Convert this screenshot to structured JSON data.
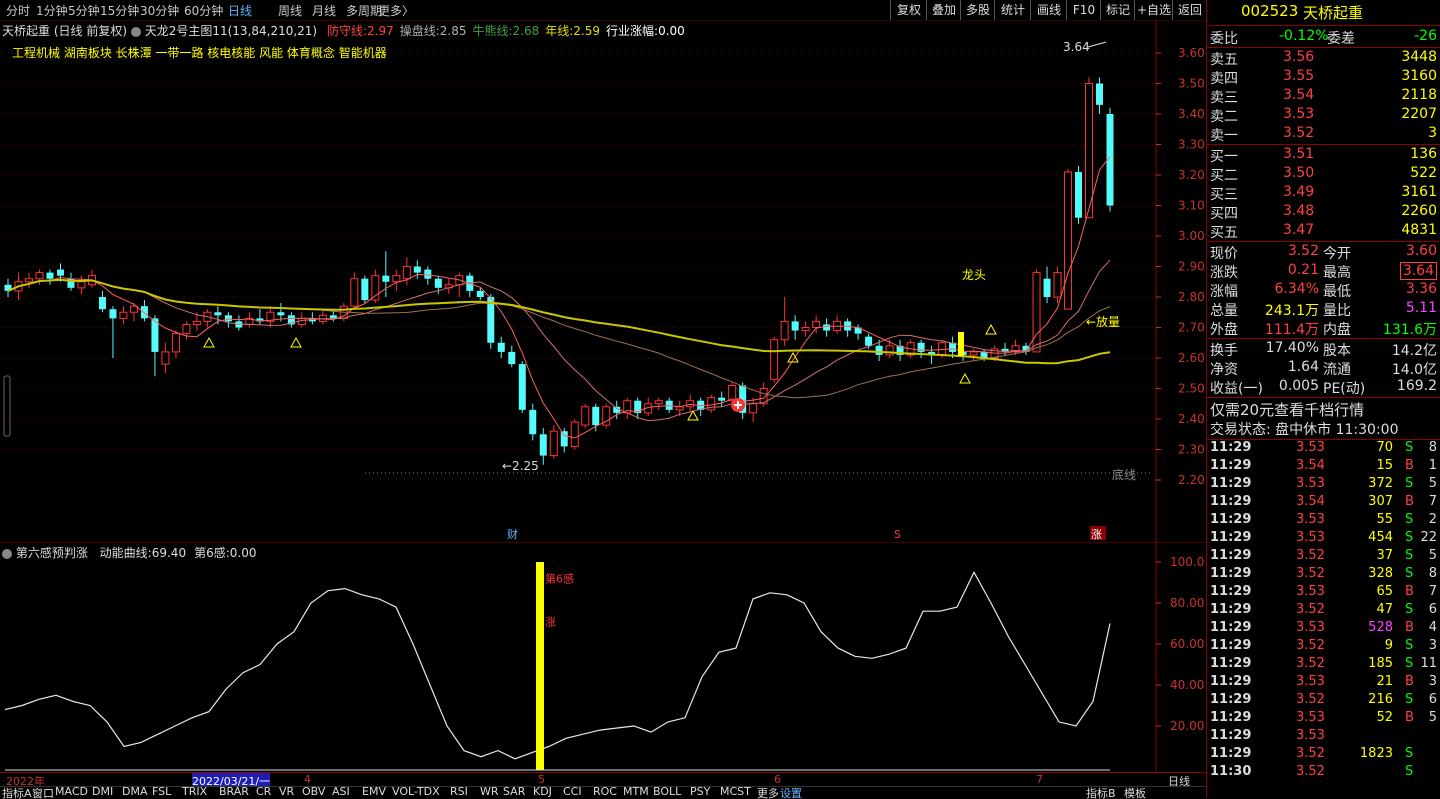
{
  "toolbar": {
    "periods": [
      "分时",
      "1分钟",
      "5分钟",
      "15分钟",
      "30分钟",
      "60分钟",
      "日线",
      "周线",
      "月线",
      "多周期",
      "更多〉"
    ],
    "active_period": "日线",
    "buttons": [
      "复权",
      "叠加",
      "多股",
      "统计",
      "画线",
      "F10",
      "标记",
      "+自选",
      "返回"
    ]
  },
  "main_header": {
    "stock_name": "天桥起重",
    "mode": "(日线 前复权)",
    "indicator_name": "天龙2号主图11(13,84,210,21)",
    "items": [
      {
        "label": "防守线:",
        "value": "2.97",
        "color": "#ff4040"
      },
      {
        "label": "操盘线:",
        "value": "2.85",
        "color": "#b0b0b0"
      },
      {
        "label": "牛熊线:",
        "value": "2.68",
        "color": "#40a040"
      },
      {
        "label": "年线:",
        "value": "2.59",
        "color": "#e0e000"
      },
      {
        "label": "行业涨幅:",
        "value": "0.00",
        "color": "#ffffff"
      }
    ],
    "concepts": "工程机械 湖南板块 长株潭 一带一路 核电核能 风能 体育概念 智能机器"
  },
  "price_axis": [
    "3.60",
    "3.50",
    "3.40",
    "3.30",
    "3.20",
    "3.10",
    "3.00",
    "2.90",
    "2.80",
    "2.70",
    "2.60",
    "2.50",
    "2.40",
    "2.30",
    "2.20"
  ],
  "annotations": {
    "high_label": "3.64",
    "low_label": "2.25",
    "bottom_line": "底线",
    "volume_label": "放量",
    "dragon_label": "龙头",
    "marker_cai": "财",
    "marker_s": "S",
    "marker_zhang": "涨"
  },
  "candles": [
    {
      "o": 2.84,
      "c": 2.82,
      "h": 2.86,
      "l": 2.8
    },
    {
      "o": 2.82,
      "c": 2.85,
      "h": 2.88,
      "l": 2.79
    },
    {
      "o": 2.85,
      "c": 2.86,
      "h": 2.88,
      "l": 2.83
    },
    {
      "o": 2.86,
      "c": 2.88,
      "h": 2.89,
      "l": 2.84
    },
    {
      "o": 2.88,
      "c": 2.86,
      "h": 2.89,
      "l": 2.84
    },
    {
      "o": 2.89,
      "c": 2.87,
      "h": 2.91,
      "l": 2.85
    },
    {
      "o": 2.86,
      "c": 2.83,
      "h": 2.88,
      "l": 2.82
    },
    {
      "o": 2.83,
      "c": 2.85,
      "h": 2.87,
      "l": 2.81
    },
    {
      "o": 2.84,
      "c": 2.87,
      "h": 2.89,
      "l": 2.83
    },
    {
      "o": 2.8,
      "c": 2.76,
      "h": 2.82,
      "l": 2.75
    },
    {
      "o": 2.76,
      "c": 2.73,
      "h": 2.77,
      "l": 2.6
    },
    {
      "o": 2.73,
      "c": 2.75,
      "h": 2.77,
      "l": 2.71
    },
    {
      "o": 2.75,
      "c": 2.77,
      "h": 2.78,
      "l": 2.72
    },
    {
      "o": 2.77,
      "c": 2.73,
      "h": 2.79,
      "l": 2.72
    },
    {
      "o": 2.73,
      "c": 2.62,
      "h": 2.74,
      "l": 2.54
    },
    {
      "o": 2.58,
      "c": 2.62,
      "h": 2.65,
      "l": 2.55
    },
    {
      "o": 2.62,
      "c": 2.68,
      "h": 2.69,
      "l": 2.6
    },
    {
      "o": 2.68,
      "c": 2.71,
      "h": 2.72,
      "l": 2.66
    },
    {
      "o": 2.71,
      "c": 2.72,
      "h": 2.75,
      "l": 2.69
    },
    {
      "o": 2.72,
      "c": 2.75,
      "h": 2.76,
      "l": 2.7
    },
    {
      "o": 2.75,
      "c": 2.74,
      "h": 2.77,
      "l": 2.71
    },
    {
      "o": 2.74,
      "c": 2.72,
      "h": 2.75,
      "l": 2.7
    },
    {
      "o": 2.72,
      "c": 2.7,
      "h": 2.74,
      "l": 2.69
    },
    {
      "o": 2.71,
      "c": 2.73,
      "h": 2.75,
      "l": 2.7
    },
    {
      "o": 2.73,
      "c": 2.72,
      "h": 2.76,
      "l": 2.71
    },
    {
      "o": 2.72,
      "c": 2.75,
      "h": 2.77,
      "l": 2.7
    },
    {
      "o": 2.75,
      "c": 2.74,
      "h": 2.78,
      "l": 2.72
    },
    {
      "o": 2.74,
      "c": 2.71,
      "h": 2.75,
      "l": 2.7
    },
    {
      "o": 2.71,
      "c": 2.73,
      "h": 2.75,
      "l": 2.7
    },
    {
      "o": 2.73,
      "c": 2.72,
      "h": 2.75,
      "l": 2.71
    },
    {
      "o": 2.72,
      "c": 2.74,
      "h": 2.76,
      "l": 2.71
    },
    {
      "o": 2.74,
      "c": 2.73,
      "h": 2.76,
      "l": 2.72
    },
    {
      "o": 2.73,
      "c": 2.77,
      "h": 2.78,
      "l": 2.72
    },
    {
      "o": 2.77,
      "c": 2.86,
      "h": 2.88,
      "l": 2.76
    },
    {
      "o": 2.86,
      "c": 2.79,
      "h": 2.87,
      "l": 2.78
    },
    {
      "o": 2.79,
      "c": 2.87,
      "h": 2.89,
      "l": 2.78
    },
    {
      "o": 2.87,
      "c": 2.85,
      "h": 2.95,
      "l": 2.8
    },
    {
      "o": 2.85,
      "c": 2.87,
      "h": 2.89,
      "l": 2.82
    },
    {
      "o": 2.86,
      "c": 2.9,
      "h": 2.93,
      "l": 2.84
    },
    {
      "o": 2.9,
      "c": 2.88,
      "h": 2.92,
      "l": 2.86
    },
    {
      "o": 2.89,
      "c": 2.86,
      "h": 2.9,
      "l": 2.84
    },
    {
      "o": 2.86,
      "c": 2.83,
      "h": 2.87,
      "l": 2.81
    },
    {
      "o": 2.83,
      "c": 2.84,
      "h": 2.86,
      "l": 2.81
    },
    {
      "o": 2.84,
      "c": 2.87,
      "h": 2.88,
      "l": 2.8
    },
    {
      "o": 2.87,
      "c": 2.82,
      "h": 2.88,
      "l": 2.8
    },
    {
      "o": 2.82,
      "c": 2.8,
      "h": 2.83,
      "l": 2.79
    },
    {
      "o": 2.8,
      "c": 2.65,
      "h": 2.81,
      "l": 2.63
    },
    {
      "o": 2.65,
      "c": 2.62,
      "h": 2.67,
      "l": 2.6
    },
    {
      "o": 2.62,
      "c": 2.58,
      "h": 2.64,
      "l": 2.57
    },
    {
      "o": 2.58,
      "c": 2.43,
      "h": 2.59,
      "l": 2.42
    },
    {
      "o": 2.43,
      "c": 2.35,
      "h": 2.45,
      "l": 2.33
    },
    {
      "o": 2.35,
      "c": 2.28,
      "h": 2.37,
      "l": 2.25
    },
    {
      "o": 2.28,
      "c": 2.36,
      "h": 2.38,
      "l": 2.27
    },
    {
      "o": 2.36,
      "c": 2.31,
      "h": 2.37,
      "l": 2.29
    },
    {
      "o": 2.31,
      "c": 2.39,
      "h": 2.4,
      "l": 2.3
    },
    {
      "o": 2.38,
      "c": 2.44,
      "h": 2.45,
      "l": 2.37
    },
    {
      "o": 2.44,
      "c": 2.38,
      "h": 2.45,
      "l": 2.36
    },
    {
      "o": 2.38,
      "c": 2.44,
      "h": 2.45,
      "l": 2.37
    },
    {
      "o": 2.44,
      "c": 2.42,
      "h": 2.46,
      "l": 2.4
    },
    {
      "o": 2.42,
      "c": 2.46,
      "h": 2.47,
      "l": 2.4
    },
    {
      "o": 2.46,
      "c": 2.42,
      "h": 2.47,
      "l": 2.4
    },
    {
      "o": 2.42,
      "c": 2.45,
      "h": 2.47,
      "l": 2.41
    },
    {
      "o": 2.45,
      "c": 2.46,
      "h": 2.47,
      "l": 2.43
    },
    {
      "o": 2.46,
      "c": 2.43,
      "h": 2.47,
      "l": 2.42
    },
    {
      "o": 2.43,
      "c": 2.44,
      "h": 2.46,
      "l": 2.41
    },
    {
      "o": 2.44,
      "c": 2.46,
      "h": 2.48,
      "l": 2.42
    },
    {
      "o": 2.46,
      "c": 2.43,
      "h": 2.47,
      "l": 2.41
    },
    {
      "o": 2.43,
      "c": 2.47,
      "h": 2.48,
      "l": 2.42
    },
    {
      "o": 2.47,
      "c": 2.46,
      "h": 2.49,
      "l": 2.44
    },
    {
      "o": 2.46,
      "c": 2.51,
      "h": 2.52,
      "l": 2.44
    },
    {
      "o": 2.51,
      "c": 2.42,
      "h": 2.52,
      "l": 2.4
    },
    {
      "o": 2.42,
      "c": 2.45,
      "h": 2.47,
      "l": 2.39
    },
    {
      "o": 2.45,
      "c": 2.5,
      "h": 2.52,
      "l": 2.44
    },
    {
      "o": 2.53,
      "c": 2.66,
      "h": 2.67,
      "l": 2.52
    },
    {
      "o": 2.66,
      "c": 2.72,
      "h": 2.8,
      "l": 2.64
    },
    {
      "o": 2.72,
      "c": 2.69,
      "h": 2.74,
      "l": 2.66
    },
    {
      "o": 2.69,
      "c": 2.7,
      "h": 2.72,
      "l": 2.67
    },
    {
      "o": 2.7,
      "c": 2.72,
      "h": 2.74,
      "l": 2.68
    },
    {
      "o": 2.71,
      "c": 2.69,
      "h": 2.73,
      "l": 2.67
    },
    {
      "o": 2.69,
      "c": 2.72,
      "h": 2.74,
      "l": 2.68
    },
    {
      "o": 2.72,
      "c": 2.69,
      "h": 2.73,
      "l": 2.67
    },
    {
      "o": 2.7,
      "c": 2.68,
      "h": 2.71,
      "l": 2.66
    },
    {
      "o": 2.67,
      "c": 2.64,
      "h": 2.68,
      "l": 2.63
    },
    {
      "o": 2.64,
      "c": 2.61,
      "h": 2.66,
      "l": 2.59
    },
    {
      "o": 2.61,
      "c": 2.64,
      "h": 2.66,
      "l": 2.6
    },
    {
      "o": 2.64,
      "c": 2.61,
      "h": 2.66,
      "l": 2.59
    },
    {
      "o": 2.61,
      "c": 2.65,
      "h": 2.66,
      "l": 2.6
    },
    {
      "o": 2.65,
      "c": 2.62,
      "h": 2.66,
      "l": 2.6
    },
    {
      "o": 2.62,
      "c": 2.61,
      "h": 2.64,
      "l": 2.58
    },
    {
      "o": 2.61,
      "c": 2.65,
      "h": 2.66,
      "l": 2.6
    },
    {
      "o": 2.65,
      "c": 2.62,
      "h": 2.67,
      "l": 2.6
    },
    {
      "o": 2.62,
      "c": 2.61,
      "h": 2.63,
      "l": 2.59
    },
    {
      "o": 2.61,
      "c": 2.62,
      "h": 2.63,
      "l": 2.59
    },
    {
      "o": 2.62,
      "c": 2.6,
      "h": 2.63,
      "l": 2.59
    },
    {
      "o": 2.6,
      "c": 2.63,
      "h": 2.64,
      "l": 2.59
    },
    {
      "o": 2.63,
      "c": 2.62,
      "h": 2.65,
      "l": 2.61
    },
    {
      "o": 2.62,
      "c": 2.64,
      "h": 2.66,
      "l": 2.61
    },
    {
      "o": 2.64,
      "c": 2.62,
      "h": 2.65,
      "l": 2.61
    },
    {
      "o": 2.62,
      "c": 2.88,
      "h": 2.89,
      "l": 2.62
    },
    {
      "o": 2.86,
      "c": 2.8,
      "h": 2.9,
      "l": 2.78
    },
    {
      "o": 2.8,
      "c": 2.88,
      "h": 2.9,
      "l": 2.78
    },
    {
      "o": 2.76,
      "c": 3.21,
      "h": 3.22,
      "l": 2.76
    },
    {
      "o": 3.21,
      "c": 3.06,
      "h": 3.23,
      "l": 3.04
    },
    {
      "o": 3.06,
      "c": 3.5,
      "h": 3.52,
      "l": 3.06
    },
    {
      "o": 3.5,
      "c": 3.43,
      "h": 3.52,
      "l": 3.4
    },
    {
      "o": 3.4,
      "c": 3.1,
      "h": 3.42,
      "l": 3.08
    }
  ],
  "indicator": {
    "name": "第六感预判涨",
    "items": [
      {
        "label": "动能曲线:",
        "value": "69.40"
      },
      {
        "label": "第6感:",
        "value": "0.00"
      }
    ],
    "axis": [
      "100.0",
      "80.00",
      "60.00",
      "40.00",
      "20.00"
    ],
    "signal_labels": [
      "第6感",
      "涨"
    ]
  },
  "date_axis": [
    "2022年",
    "2022/03/21/一",
    "4",
    "5",
    "6",
    "7"
  ],
  "bottom_tabs": [
    "指标A",
    "窗口",
    "MACD",
    "DMI",
    "DMA",
    "FSL",
    "TRIX",
    "BRAR",
    "CR",
    "VR",
    "OBV",
    "ASI",
    "EMV",
    "VOL-TDX",
    "RSI",
    "WR",
    "SAR",
    "KDJ",
    "CCI",
    "ROC",
    "MTM",
    "BOLL",
    "PSY",
    "MCST",
    "更多",
    "设置"
  ],
  "bottom_right": [
    "指标B",
    "模板",
    "日线"
  ],
  "quote": {
    "code": "002523",
    "name": "天桥起重",
    "wei_bi": "-0.12%",
    "wei_cha": "-26",
    "sells": [
      {
        "label": "卖五",
        "price": "3.56",
        "vol": "3448"
      },
      {
        "label": "卖四",
        "price": "3.55",
        "vol": "3160"
      },
      {
        "label": "卖三",
        "price": "3.54",
        "vol": "2118"
      },
      {
        "label": "卖二",
        "price": "3.53",
        "vol": "2207"
      },
      {
        "label": "卖一",
        "price": "3.52",
        "vol": "3"
      }
    ],
    "buys": [
      {
        "label": "买一",
        "price": "3.51",
        "vol": "136"
      },
      {
        "label": "买二",
        "price": "3.50",
        "vol": "522"
      },
      {
        "label": "买三",
        "price": "3.49",
        "vol": "3161"
      },
      {
        "label": "买四",
        "price": "3.48",
        "vol": "2260"
      },
      {
        "label": "买五",
        "price": "3.47",
        "vol": "4831"
      }
    ],
    "stats": [
      {
        "l1": "现价",
        "v1": "3.52",
        "c1": "#ff4040",
        "l2": "今开",
        "v2": "3.60",
        "c2": "#ff4040"
      },
      {
        "l1": "涨跌",
        "v1": "0.21",
        "c1": "#ff4040",
        "l2": "最高",
        "v2": "3.64",
        "c2": "#ff4040"
      },
      {
        "l1": "涨幅",
        "v1": "6.34%",
        "c1": "#ff4040",
        "l2": "最低",
        "v2": "3.36",
        "c2": "#ff4040"
      },
      {
        "l1": "总量",
        "v1": "243.1万",
        "c1": "#ffff00",
        "l2": "量比",
        "v2": "5.11",
        "c2": "#ff40ff"
      },
      {
        "l1": "外盘",
        "v1": "111.4万",
        "c1": "#ff4040",
        "l2": "内盘",
        "v2": "131.6万",
        "c2": "#00ff00"
      }
    ],
    "stats2": [
      {
        "l1": "换手",
        "v1": "17.40%",
        "l2": "股本",
        "v2": "14.2亿"
      },
      {
        "l1": "净资",
        "v1": "1.64",
        "l2": "流通",
        "v2": "14.0亿"
      },
      {
        "l1": "收益(一)",
        "v1": "0.005",
        "l2": "PE(动)",
        "v2": "169.2"
      }
    ],
    "promo": "仅需20元查看千档行情",
    "trade_status": "交易状态: 盘中休市 11:30:00",
    "ticks": [
      {
        "t": "11:29",
        "p": "3.53",
        "v": "70",
        "s": "S",
        "n": "8"
      },
      {
        "t": "11:29",
        "p": "3.54",
        "v": "15",
        "s": "B",
        "n": "1"
      },
      {
        "t": "11:29",
        "p": "3.53",
        "v": "372",
        "s": "S",
        "n": "5"
      },
      {
        "t": "11:29",
        "p": "3.54",
        "v": "307",
        "s": "B",
        "n": "7"
      },
      {
        "t": "11:29",
        "p": "3.53",
        "v": "55",
        "s": "S",
        "n": "2"
      },
      {
        "t": "11:29",
        "p": "3.53",
        "v": "454",
        "s": "S",
        "n": "22"
      },
      {
        "t": "11:29",
        "p": "3.52",
        "v": "37",
        "s": "S",
        "n": "5"
      },
      {
        "t": "11:29",
        "p": "3.52",
        "v": "328",
        "s": "S",
        "n": "8"
      },
      {
        "t": "11:29",
        "p": "3.53",
        "v": "65",
        "s": "B",
        "n": "7"
      },
      {
        "t": "11:29",
        "p": "3.52",
        "v": "47",
        "s": "S",
        "n": "6"
      },
      {
        "t": "11:29",
        "p": "3.53",
        "v": "528",
        "s": "B",
        "n": "4"
      },
      {
        "t": "11:29",
        "p": "3.52",
        "v": "9",
        "s": "S",
        "n": "3"
      },
      {
        "t": "11:29",
        "p": "3.52",
        "v": "185",
        "s": "S",
        "n": "11"
      },
      {
        "t": "11:29",
        "p": "3.53",
        "v": "21",
        "s": "B",
        "n": "3"
      },
      {
        "t": "11:29",
        "p": "3.52",
        "v": "216",
        "s": "S",
        "n": "6"
      },
      {
        "t": "11:29",
        "p": "3.53",
        "v": "52",
        "s": "B",
        "n": "5"
      },
      {
        "t": "11:29",
        "p": "3.53",
        "v": "",
        "s": "",
        "n": ""
      },
      {
        "t": "11:29",
        "p": "3.52",
        "v": "1823",
        "s": "S",
        "n": ""
      },
      {
        "t": "11:30",
        "p": "3.52",
        "v": "",
        "s": "S",
        "n": ""
      }
    ]
  },
  "colors": {
    "up": "#ff3232",
    "down": "#54fcfc",
    "grid": "#5a0000",
    "ma_year": "#c8c800",
    "ma_red": "#ff4040"
  }
}
